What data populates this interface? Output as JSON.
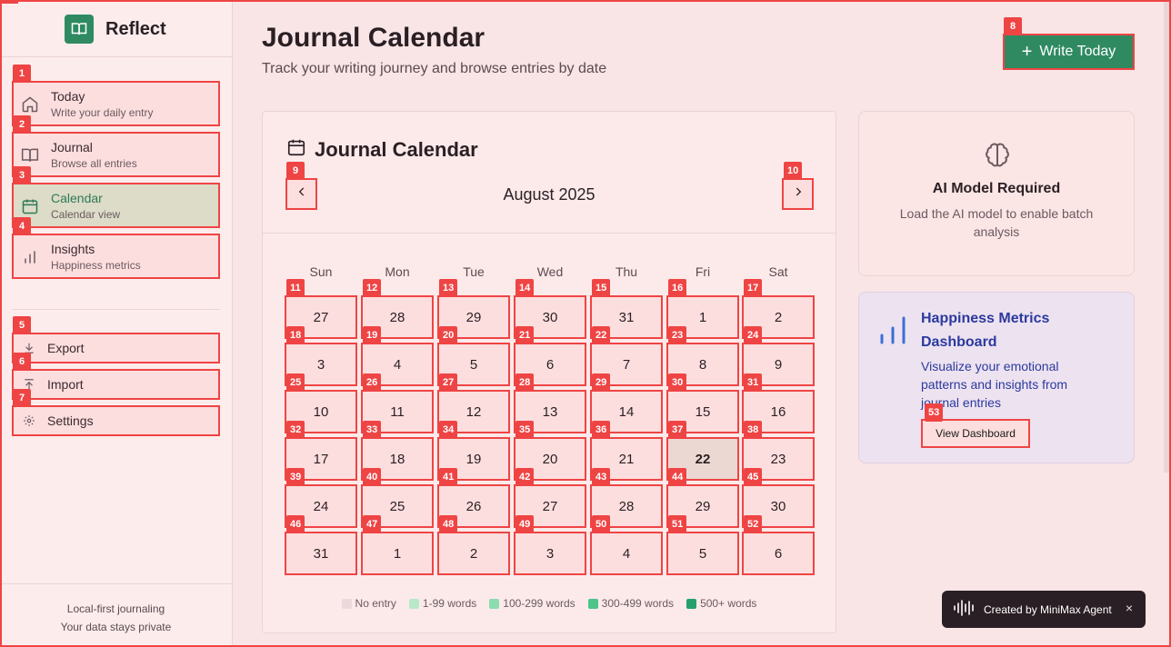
{
  "app": {
    "name": "Reflect"
  },
  "sidebar": {
    "items": [
      {
        "badge": "1",
        "label": "Today",
        "sub": "Write your daily entry",
        "icon": "home-icon"
      },
      {
        "badge": "2",
        "label": "Journal",
        "sub": "Browse all entries",
        "icon": "book-icon"
      },
      {
        "badge": "3",
        "label": "Calendar",
        "sub": "Calendar view",
        "icon": "calendar-icon",
        "active": true
      },
      {
        "badge": "4",
        "label": "Insights",
        "sub": "Happiness metrics",
        "icon": "bar-chart-icon"
      }
    ],
    "utilities": [
      {
        "badge": "5",
        "label": "Export",
        "icon": "download-icon"
      },
      {
        "badge": "6",
        "label": "Import",
        "icon": "upload-icon"
      },
      {
        "badge": "7",
        "label": "Settings",
        "icon": "gear-icon"
      }
    ],
    "footer": [
      "Local-first journaling",
      "Your data stays private"
    ]
  },
  "header": {
    "title": "Journal Calendar",
    "subtitle": "Track your writing journey and browse entries by date",
    "write_badge": "8",
    "write_label": "Write Today"
  },
  "calendar": {
    "title": "Journal Calendar",
    "month": "August 2025",
    "prev_badge": "9",
    "next_badge": "10",
    "weekdays": [
      "Sun",
      "Mon",
      "Tue",
      "Wed",
      "Thu",
      "Fri",
      "Sat"
    ],
    "days": [
      "27",
      "28",
      "29",
      "30",
      "31",
      "1",
      "2",
      "3",
      "4",
      "5",
      "6",
      "7",
      "8",
      "9",
      "10",
      "11",
      "12",
      "13",
      "14",
      "15",
      "16",
      "17",
      "18",
      "19",
      "20",
      "21",
      "22",
      "23",
      "24",
      "25",
      "26",
      "27",
      "28",
      "29",
      "30",
      "31",
      "1",
      "2",
      "3",
      "4",
      "5",
      "6"
    ],
    "badge_start": 11,
    "today_index": 26,
    "legend": [
      {
        "label": "No entry",
        "color": "#ecd9dc"
      },
      {
        "label": "1-99 words",
        "color": "#b9e8c9"
      },
      {
        "label": "100-299 words",
        "color": "#8bdcae"
      },
      {
        "label": "300-499 words",
        "color": "#4cc48a"
      },
      {
        "label": "500+ words",
        "color": "#25a06a"
      }
    ]
  },
  "ai_card": {
    "title": "AI Model Required",
    "description": "Load the AI model to enable batch analysis"
  },
  "metrics_card": {
    "title": "Happiness Metrics Dashboard",
    "description": "Visualize your emotional patterns and insights from journal entries",
    "button_badge": "53",
    "button_label": "View Dashboard"
  },
  "toast": {
    "label": "Created by MiniMax Agent",
    "close": "×"
  }
}
